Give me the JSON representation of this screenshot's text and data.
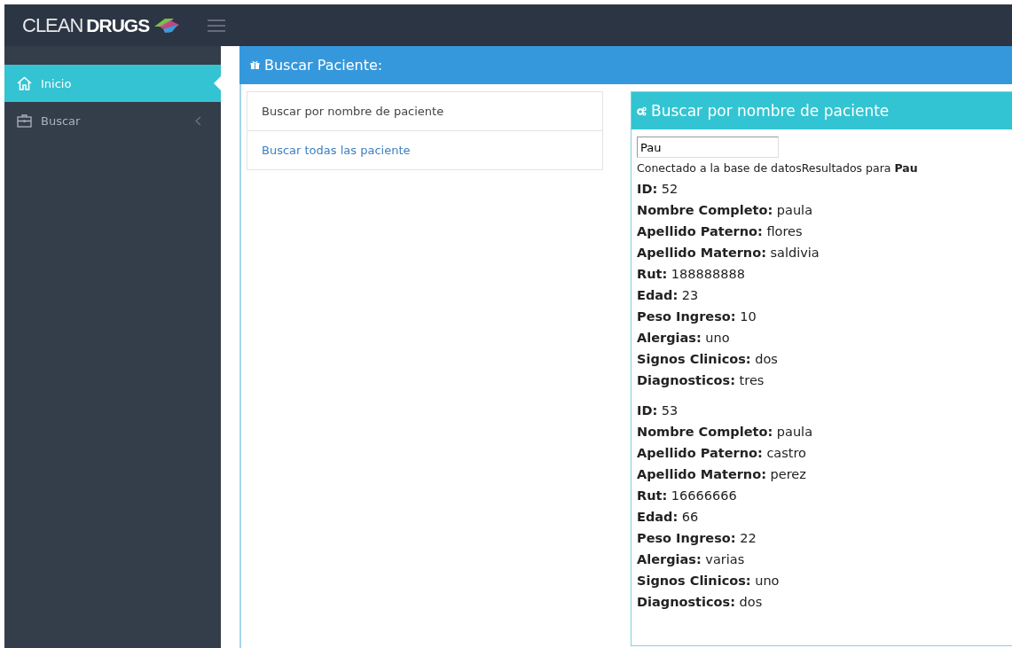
{
  "logo": {
    "light": "CLEAN",
    "bold": "DRUGS"
  },
  "sidebar": {
    "items": [
      {
        "label": "Inicio",
        "kind": "home",
        "selected": true,
        "has_submenu": false
      },
      {
        "label": "Buscar",
        "kind": "briefcase",
        "selected": false,
        "has_submenu": true
      }
    ]
  },
  "panel": {
    "title": "Buscar Paciente:"
  },
  "search_options": [
    {
      "label": "Buscar por nombre de paciente",
      "selected": true
    },
    {
      "label": "Buscar todas las paciente",
      "selected": false
    }
  ],
  "results_panel": {
    "title": "Buscar por nombre de paciente",
    "query": "Pau",
    "status": "Conectado a la base de datosResultados para **Pau**",
    "records": [
      [
        {
          "label": "ID:",
          "value": "52"
        },
        {
          "label": "Nombre Completo:",
          "value": "paula"
        },
        {
          "label": "Apellido Paterno:",
          "value": "flores"
        },
        {
          "label": "Apellido Materno:",
          "value": "saldivia"
        },
        {
          "label": "Rut:",
          "value": "188888888"
        },
        {
          "label": "Edad:",
          "value": "23"
        },
        {
          "label": "Peso Ingreso:",
          "value": "10"
        },
        {
          "label": "Alergias:",
          "value": "uno"
        },
        {
          "label": "Signos Clinicos:",
          "value": "dos"
        },
        {
          "label": "Diagnosticos:",
          "value": "tres"
        }
      ],
      [
        {
          "label": "ID:",
          "value": "53"
        },
        {
          "label": "Nombre Completo:",
          "value": "paula"
        },
        {
          "label": "Apellido Paterno:",
          "value": "castro"
        },
        {
          "label": "Apellido Materno:",
          "value": "perez"
        },
        {
          "label": "Rut:",
          "value": "16666666"
        },
        {
          "label": "Edad:",
          "value": "66"
        },
        {
          "label": "Peso Ingreso:",
          "value": "22"
        },
        {
          "label": "Alergias:",
          "value": "varias"
        },
        {
          "label": "Signos Clinicos:",
          "value": "uno"
        },
        {
          "label": "Diagnosticos:",
          "value": "dos"
        }
      ]
    ]
  }
}
